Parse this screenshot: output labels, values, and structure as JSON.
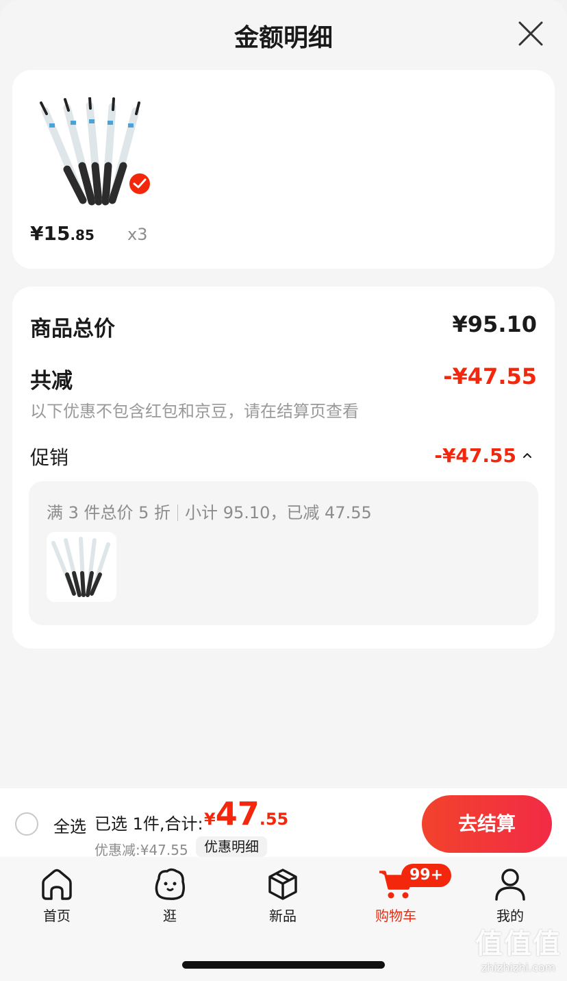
{
  "sheet": {
    "title": "金额明细"
  },
  "item": {
    "price_int": "¥15",
    "price_dec": ".85",
    "qty": "x3"
  },
  "summary": {
    "total_label": "商品总价",
    "total_value": "¥95.10",
    "reduce_label": "共减",
    "reduce_value": "-¥47.55",
    "note": "以下优惠不包含红包和京豆，请在结算页查看",
    "promo_label": "促销",
    "promo_value": "-¥47.55",
    "promo_rule": "满 3 件总价 5 折",
    "promo_subtotal": "小计 95.10，已减 47.55"
  },
  "checkout": {
    "select_all": "全选",
    "selected": "已选 1件,合计:",
    "total_symbol": "¥",
    "total_int": "47",
    "total_dec": ".55",
    "discount": "优惠减:¥47.55",
    "detail": "优惠明细",
    "button": "去结算"
  },
  "tabbar": {
    "home": "首页",
    "browse": "逛",
    "new": "新品",
    "cart": "购物车",
    "cart_badge": "99+",
    "mine": "我的"
  },
  "watermark": {
    "glyphs": "值值值",
    "url": "zhizhizhi.com"
  },
  "colors": {
    "accent": "#f2270c",
    "muted": "#8c8c8c",
    "background": "#f5f5f5"
  }
}
